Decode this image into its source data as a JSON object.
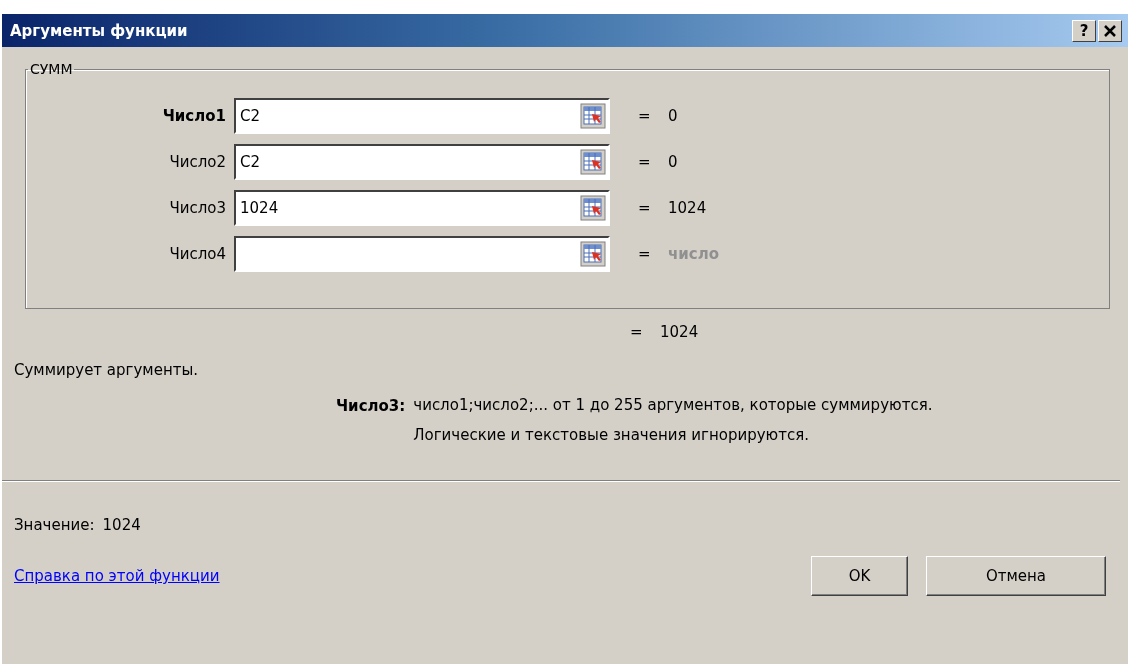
{
  "window": {
    "title": "Аргументы функции",
    "help_button": "?"
  },
  "group": {
    "title": "СУММ",
    "arguments": [
      {
        "label": "Число1",
        "value": "C2",
        "equals": "=",
        "result": "0",
        "active": true,
        "muted": false
      },
      {
        "label": "Число2",
        "value": "C2",
        "equals": "=",
        "result": "0",
        "active": false,
        "muted": false
      },
      {
        "label": "Число3",
        "value": "1024",
        "equals": "=",
        "result": "1024",
        "active": false,
        "muted": false
      },
      {
        "label": "Число4",
        "equals": "=",
        "result": "число",
        "active": false,
        "muted": true
      }
    ]
  },
  "formula_result": {
    "equals": "=",
    "value": "1024"
  },
  "description": "Суммирует аргументы.",
  "argument_help": {
    "label": "Число3:",
    "lines": [
      "число1;число2;... от 1 до 255 аргументов, которые суммируются.",
      "Логические и текстовые значения игнорируются."
    ]
  },
  "value": {
    "label": "Значение:",
    "text": "1024"
  },
  "help_link": "Справка по этой функции",
  "buttons": [
    "OK",
    "Отмена"
  ]
}
